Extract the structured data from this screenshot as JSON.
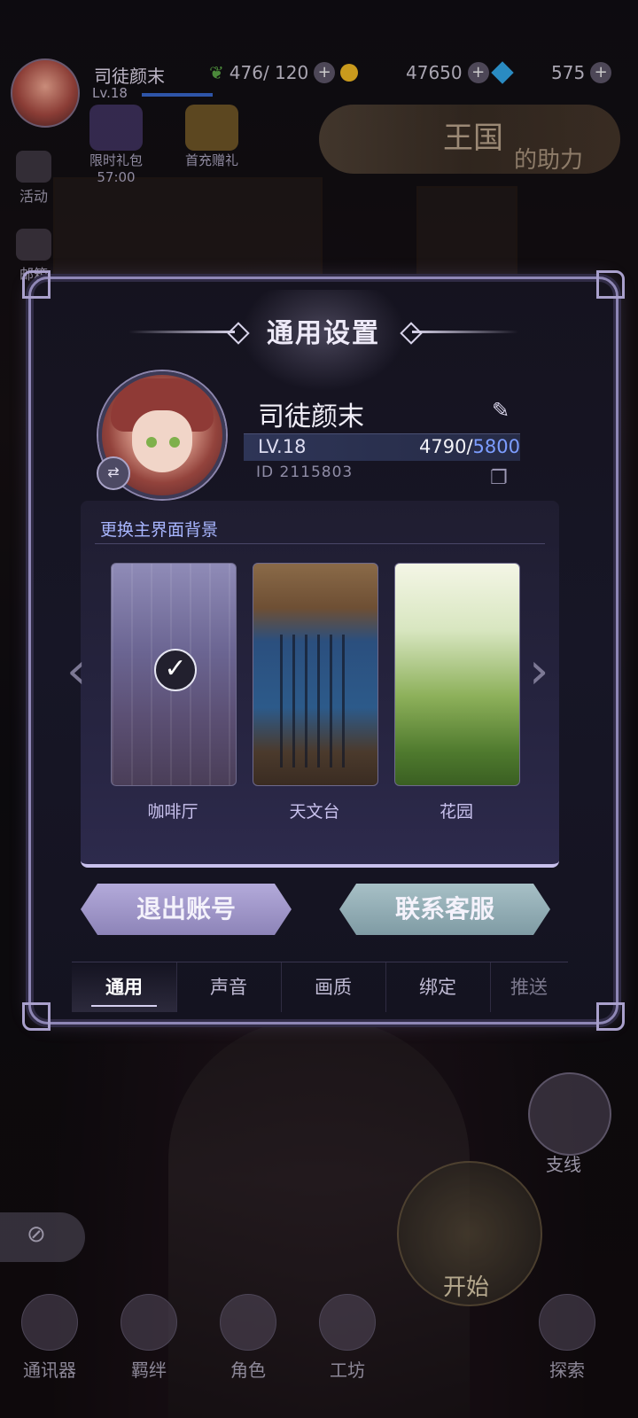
{
  "hud": {
    "player_name": "司徒颜末",
    "level": "Lv.18",
    "stamina": "476/ 120",
    "gold": "47650",
    "gems": "575",
    "limited_gift_label": "限时礼包",
    "limited_gift_timer": "57:00",
    "first_recharge_label": "首充赠礼",
    "kingdom_title": "王国",
    "kingdom_sub": "的助力"
  },
  "left_side": {
    "items": [
      {
        "label": "活动",
        "icon": "activity-icon"
      },
      {
        "label": "邮箱",
        "icon": "mail-icon"
      }
    ]
  },
  "modal": {
    "title": "通用设置",
    "profile": {
      "name": "司徒颜末",
      "level": "LV.18",
      "exp_current": "4790",
      "exp_separator": "/",
      "exp_max": "5800",
      "id": "ID  2115803"
    },
    "background_section": {
      "label": "更换主界面背景",
      "options": [
        {
          "name": "咖啡厅",
          "selected": true
        },
        {
          "name": "天文台",
          "selected": false
        },
        {
          "name": "花园",
          "selected": false
        }
      ]
    },
    "buttons": {
      "logout": "退出账号",
      "support": "联系客服"
    },
    "tabs": [
      "通用",
      "声音",
      "画质",
      "绑定",
      "推送"
    ],
    "active_tab": "通用"
  },
  "bottom_nav": {
    "items": [
      "通讯器",
      "羁绊",
      "角色",
      "工坊",
      "探索"
    ],
    "start_label": "开始",
    "branch_label": "支线"
  },
  "colors": {
    "accent_purple": "#8f87b6",
    "exp_max": "#7c9dff",
    "section_label": "#a8b6ff"
  }
}
